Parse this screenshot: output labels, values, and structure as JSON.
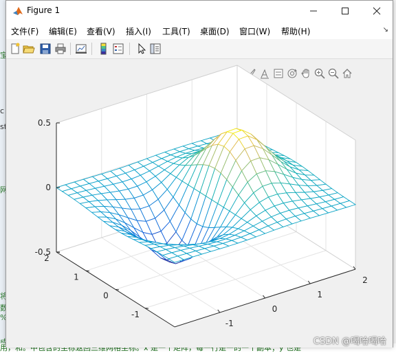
{
  "window": {
    "title": "Figure 1",
    "minimize": "—",
    "maximize": "☐",
    "close": "✕"
  },
  "menu": {
    "items": [
      {
        "label": "文件(F)"
      },
      {
        "label": "编辑(E)"
      },
      {
        "label": "查看(V)"
      },
      {
        "label": "插入(I)"
      },
      {
        "label": "工具(T)"
      },
      {
        "label": "桌面(D)"
      },
      {
        "label": "窗口(W)"
      },
      {
        "label": "帮助(H)"
      }
    ],
    "overflow": "↘"
  },
  "toolbar": {
    "icons": [
      "new-figure-icon",
      "open-file-icon",
      "save-icon",
      "print-icon",
      "link-plot-icon",
      "insert-colorbar-icon",
      "insert-legend-icon",
      "edit-plot-icon",
      "property-inspector-icon"
    ]
  },
  "axes_toolbar": {
    "icons": [
      "brush-icon",
      "data-tips-icon",
      "restore-view-icon",
      "rotate-3d-icon",
      "pan-icon",
      "zoom-in-icon",
      "zoom-out-icon",
      "home-icon"
    ]
  },
  "chart_data": {
    "type": "surface-mesh",
    "function": "z = x * exp(-x^2 - y^2)",
    "x_range": [
      -2,
      2
    ],
    "y_range": [
      -2,
      2
    ],
    "z_range": [
      -0.5,
      0.5
    ],
    "grid_points": 21,
    "z_ticks": [
      "0.5",
      "0",
      "-0.5"
    ],
    "x_ticks": [
      "-1",
      "0",
      "1",
      "2"
    ],
    "y_ticks": [
      "2",
      "1",
      "0",
      "-1"
    ],
    "grid": true,
    "colormap": "parula"
  },
  "background": {
    "left_fragments": [
      "宝",
      "c",
      "st",
      "网",
      "将",
      "数",
      "%",
      "成"
    ],
    "bottom_line": "用，和。中包含的坐标返回三维网格坐标。x 是一个矩阵，每一行是一的一个副本；y 也是",
    "watermark": "CSDN @喝哈喝哈"
  }
}
